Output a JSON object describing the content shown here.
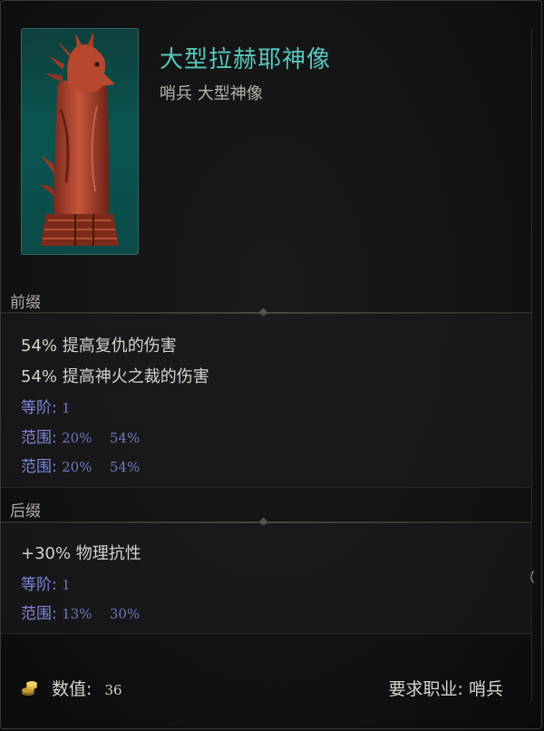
{
  "item": {
    "name": "大型拉赫耶神像",
    "type": "哨兵 大型神像"
  },
  "prefix": {
    "header": "前缀",
    "lines": [
      "54% 提高复仇的伤害",
      "54% 提高神火之裁的伤害"
    ],
    "tier_label": "等阶:",
    "tier_value": "1",
    "ranges": [
      {
        "label": "范围:",
        "min": "20%",
        "max": "54%"
      },
      {
        "label": "范围:",
        "min": "20%",
        "max": "54%"
      }
    ]
  },
  "suffix": {
    "header": "后缀",
    "lines": [
      "+30% 物理抗性"
    ],
    "tier_label": "等阶:",
    "tier_value": "1",
    "ranges": [
      {
        "label": "范围:",
        "min": "13%",
        "max": "30%"
      }
    ]
  },
  "footer": {
    "value_label": "数值:",
    "value": "36",
    "requirement": "要求职业: 哨兵"
  },
  "colors": {
    "name": "#58c7bd",
    "stat_blue": "#7d86d8",
    "text": "#d6d2ca",
    "portrait_bg": "#0a5550"
  },
  "icons": {
    "portrait": "red-bird-idol-icon",
    "currency": "gold-coin-stack-icon"
  }
}
